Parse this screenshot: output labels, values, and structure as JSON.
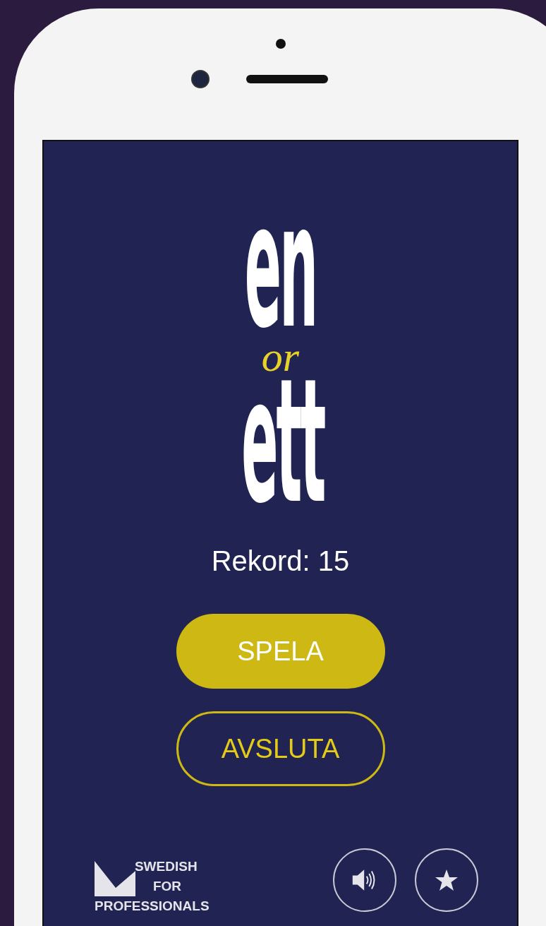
{
  "logo": {
    "first": "en",
    "middle": "or",
    "last": "ett"
  },
  "record": "Rekord: 15",
  "buttons": [
    {
      "label": "SPELA",
      "kind": "primary"
    },
    {
      "label": "AVSLUTA",
      "kind": "outline"
    }
  ],
  "brand": {
    "lines": [
      "SWEDISH",
      "FOR",
      "PROFESSIONALS"
    ]
  },
  "icon_buttons": [
    {
      "kind": "sound"
    },
    {
      "kind": "star"
    }
  ]
}
